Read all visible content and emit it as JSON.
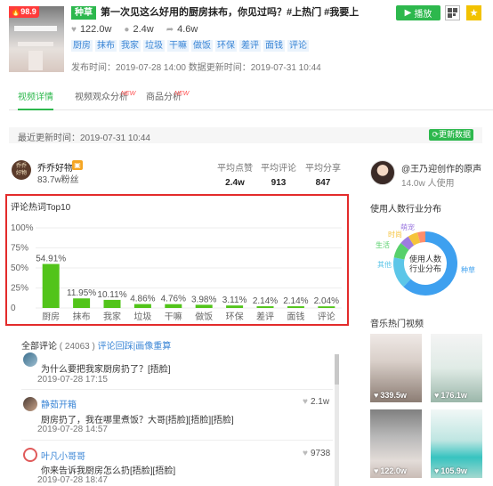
{
  "video": {
    "score": "98.9",
    "tag": "种草",
    "title": "第一次见这么好用的厨房抹布，你见过吗？#上热门 #我要上热门 #v...",
    "stats": [
      {
        "icon": "heart-icon",
        "value": "122.0w"
      },
      {
        "icon": "comment-icon",
        "value": "2.4w"
      },
      {
        "icon": "share-icon",
        "value": "4.6w"
      }
    ],
    "tags": [
      "厨房",
      "抹布",
      "我家",
      "垃圾",
      "干嘛",
      "做饭",
      "环保",
      "差评",
      "面钱",
      "评论"
    ],
    "publish_label": "发布时间：2019-07-28 14:00 数据更新时间：2019-07-31 10:44",
    "play_label": "播放"
  },
  "tabs": [
    {
      "label": "视频详情",
      "active": true,
      "new": ""
    },
    {
      "label": "视频观众分析",
      "active": false,
      "new": "NEW"
    },
    {
      "label": "商品分析",
      "active": false,
      "new": "NEW"
    }
  ],
  "update": {
    "text": "最近更新时间：2019-07-31 10:44",
    "button": "更新数据"
  },
  "author": {
    "avatar_text": "乔乔\n好物",
    "name": "乔乔好物",
    "fans": "83.7w粉丝",
    "metrics": [
      {
        "label": "平均点赞",
        "value": "2.4w"
      },
      {
        "label": "平均评论",
        "value": "913"
      },
      {
        "label": "平均分享",
        "value": "847"
      }
    ]
  },
  "chart_data": {
    "type": "bar",
    "title": "评论热词Top10",
    "categories": [
      "厨房",
      "抹布",
      "我家",
      "垃圾",
      "干嘛",
      "做饭",
      "环保",
      "差评",
      "面钱",
      "评论"
    ],
    "values": [
      54.91,
      11.95,
      10.11,
      4.86,
      4.76,
      3.98,
      3.11,
      2.14,
      2.14,
      2.04
    ],
    "value_labels": [
      "54.91%",
      "11.95%",
      "10.11%",
      "4.86%",
      "4.76%",
      "3.98%",
      "3.11%",
      "2.14%",
      "2.14%",
      "2.04%"
    ],
    "yticks": [
      "0",
      "25%",
      "50%",
      "75%",
      "100%"
    ],
    "ylim": [
      0,
      100
    ],
    "color": "#52c41a",
    "grid": true
  },
  "comments": {
    "label": "全部评论",
    "count": "( 24063 )",
    "links": [
      "评论回踩",
      "画像重算"
    ],
    "items": [
      {
        "name": "",
        "text": "为什么要把我家厨房扔了？[捂脸]",
        "time": "2019-07-28 17:15",
        "likes": ""
      },
      {
        "name": "静茹开箱",
        "text": "厨房扔了，我在哪里煮饭？大哥[捂脸][捂脸][捂脸]",
        "time": "2019-07-28 14:57",
        "likes": "2.1w"
      },
      {
        "name": "叶凡小哥哥",
        "text": "你来告诉我厨房怎么扔[捂脸][捂脸]",
        "time": "2019-07-28 18:47",
        "likes": "9738"
      }
    ]
  },
  "music": {
    "name": "@王乃迎创作的原声",
    "usage": "14.0w 人使用",
    "dist_title": "使用人数行业分布",
    "donut_center": [
      "使用人数",
      "行业分布"
    ],
    "segments": [
      {
        "label": "种草",
        "value": 62,
        "color": "#3ea0ef"
      },
      {
        "label": "其他",
        "value": 16,
        "color": "#5cc6e8"
      },
      {
        "label": "生活",
        "value": 8,
        "color": "#57d06b"
      },
      {
        "label": "萌宠",
        "value": 5,
        "color": "#9d7be0"
      },
      {
        "label": "时尚",
        "value": 5,
        "color": "#f5c33b"
      },
      {
        "label": "",
        "value": 4,
        "color": "#ff8e6b"
      }
    ],
    "hot_title": "音乐热门视频",
    "videos": [
      {
        "likes": "339.5w",
        "bg": "linear-gradient(180deg,#efe9e6 0%,#d9cfc9 40%,#8c7d74 100%)"
      },
      {
        "likes": "176.1w",
        "bg": "linear-gradient(180deg,#f4f4f4 0%,#e0ebe6 50%,#9bb7aa 100%)"
      },
      {
        "likes": "122.0w",
        "bg": "linear-gradient(180deg,#808080 0%,#b9b9b9 40%,#e3dcd8 75%,#c9bcb6 100%)"
      },
      {
        "likes": "105.9w",
        "bg": "linear-gradient(180deg,#f1f7f6 0%,#bfe6e2 45%,#37c3c0 70%,#a3d8cf 100%)"
      }
    ]
  }
}
